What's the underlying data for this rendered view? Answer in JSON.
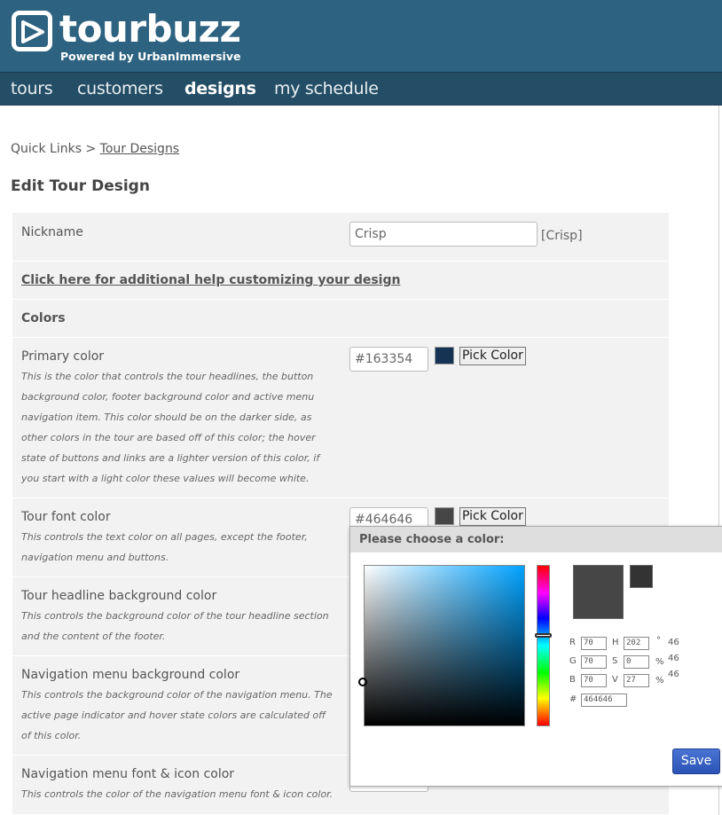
{
  "brand": {
    "name": "tourbuzz",
    "tagline": "Powered by UrbanImmersive"
  },
  "nav": {
    "tours": "tours",
    "customers": "customers",
    "designs": "designs",
    "schedule": "my schedule",
    "active": "designs"
  },
  "breadcrumb": {
    "root": "Quick Links",
    "separator": ">",
    "current": "Tour Designs"
  },
  "page_title": "Edit Tour Design",
  "form": {
    "nickname": {
      "label": "Nickname",
      "value": "Crisp",
      "aside": "[Crisp]"
    },
    "help_link": "Click here for additional help customizing your design",
    "colors_header": "Colors",
    "pick_label": "Pick Color",
    "primary": {
      "label": "Primary color",
      "value": "#163354",
      "swatch": "#163354",
      "desc": "This is the color that controls the tour headlines, the button background color, footer background color and active menu navigation item. This color should be on the darker side, as other colors in the tour are based off of this color; the hover state of buttons and links are a lighter version of this color, if you start with a light color these values will become white."
    },
    "font": {
      "label": "Tour font color",
      "value": "#464646",
      "swatch": "#464646",
      "desc": "This controls the text color on all pages, except the footer, navigation menu and buttons."
    },
    "headline_bg": {
      "label": "Tour headline background color",
      "desc": "This controls the background color of the tour headline section and the content of the footer."
    },
    "nav_bg": {
      "label": "Navigation menu background color",
      "desc": "This controls the background color of the navigation menu. The active page indicator and hover state colors are calculated off of this color."
    },
    "nav_font": {
      "label": "Navigation menu font & icon color",
      "desc": "This controls the color of the navigation menu font & icon color."
    }
  },
  "picker": {
    "title": "Please choose a color:",
    "r": "70",
    "g": "70",
    "b": "70",
    "h": "202",
    "s": "0",
    "v": "27",
    "hex": "464646",
    "deg": "°",
    "pct": "%",
    "side": [
      "46",
      "46",
      "46"
    ],
    "saturation": 0.0,
    "value": 0.27,
    "hue_deg": 202,
    "new_color": "#464646",
    "current_color": "#333333",
    "save": "Save"
  }
}
